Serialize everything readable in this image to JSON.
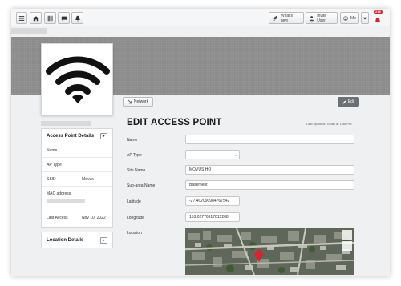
{
  "topbar": {
    "whats_new": "What's new",
    "invite_user": "Invite User",
    "me": "Me",
    "notification_badge": "218"
  },
  "toolbar": {
    "network_label": "Network",
    "edit_label": "Edit"
  },
  "access_point_panel": {
    "title": "Access Point Details",
    "rows": [
      {
        "key": "Name",
        "value": ""
      },
      {
        "key": "AP Type",
        "value": ""
      },
      {
        "key": "SSID",
        "value": "Movus"
      },
      {
        "key": "MAC address",
        "value": ""
      },
      {
        "key": "Last Access",
        "value": "Nov 10, 2022"
      }
    ]
  },
  "location_panel": {
    "title": "Location Details"
  },
  "form": {
    "title": "EDIT ACCESS POINT",
    "last_updated": "Last updated: Today at 1:56 PM",
    "name_label": "Name",
    "name_value": "",
    "ap_type_label": "AP Type",
    "ap_type_value": "",
    "site_name_label": "Site Name",
    "site_name_value": "MOVUS HQ",
    "sub_area_label": "Sub-area Name",
    "sub_area_value": "Basement",
    "latitude_label": "Latitude",
    "latitude_value": "-27.462090984767542",
    "longitude_label": "Longitude",
    "longitude_value": "153.02776917815208",
    "location_label": "Location"
  },
  "colors": {
    "banner": "#8c8c8c",
    "badge": "#d9232d",
    "edit_button": "#6b7075"
  },
  "icons": [
    "menu-icon",
    "home-icon",
    "grid-icon",
    "chat-icon",
    "bell-icon",
    "rocket-icon",
    "user-icon",
    "avatar-icon",
    "alarm-icon",
    "wifi-icon",
    "network-icon",
    "edit-icon"
  ]
}
